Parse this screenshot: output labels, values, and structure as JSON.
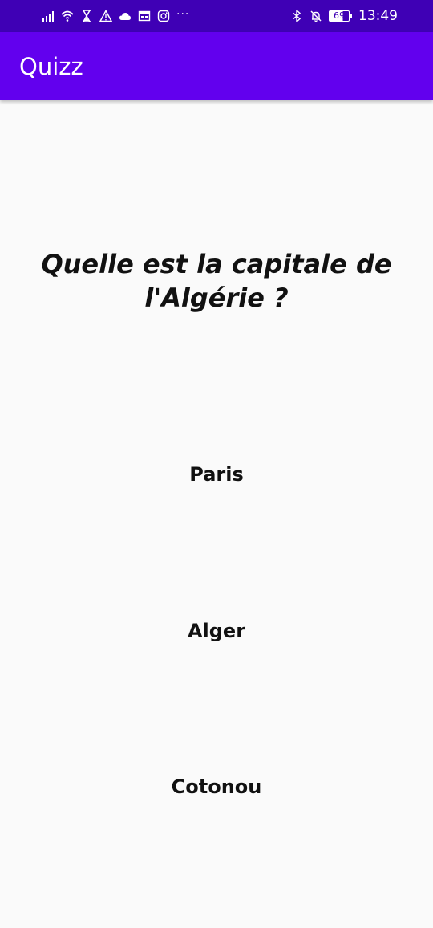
{
  "status_bar": {
    "left_icons": [
      "signal-icon",
      "wifi-icon",
      "hourglass-icon",
      "warning-icon",
      "cloud-icon",
      "calendar-icon",
      "instagram-icon",
      "more-notifications-icon"
    ],
    "more_label": "···",
    "right_icons": [
      "bluetooth-icon",
      "notifications-off-icon",
      "battery-icon"
    ],
    "battery_level": "69",
    "time": "13:49",
    "background_color": "#3f00b5"
  },
  "app_bar": {
    "title": "Quizz",
    "background_color": "#6200ee"
  },
  "quiz": {
    "question": "Quelle est la capitale de l'Algérie ?",
    "answers": [
      {
        "label": "Paris"
      },
      {
        "label": "Alger"
      },
      {
        "label": "Cotonou"
      }
    ]
  }
}
